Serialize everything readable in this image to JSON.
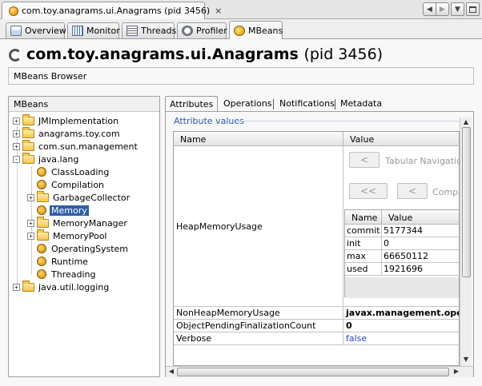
{
  "document_tab": {
    "title": "com.toy.anagrams.ui.Anagrams (pid 3456)",
    "close_glyph": "×"
  },
  "window_controls": {
    "prev_glyph": "◀",
    "next_glyph": "▶",
    "menu_glyph": "▼"
  },
  "tabs": [
    {
      "label": "Overview",
      "icon": "overview-icon"
    },
    {
      "label": "Monitor",
      "icon": "monitor-icon"
    },
    {
      "label": "Threads",
      "icon": "threads-icon"
    },
    {
      "label": "Profiler",
      "icon": "profiler-icon"
    },
    {
      "label": "MBeans",
      "icon": "mbeans-icon",
      "active": true
    }
  ],
  "header": {
    "title": "com.toy.anagrams.ui.Anagrams",
    "pid": "(pid 3456)"
  },
  "browser_label": "MBeans Browser",
  "tree": {
    "header": "MBeans",
    "items": [
      {
        "label": "JMImplementation",
        "type": "folder",
        "expander": "+"
      },
      {
        "label": "anagrams.toy.com",
        "type": "folder",
        "expander": "+"
      },
      {
        "label": "com.sun.management",
        "type": "folder",
        "expander": "+"
      },
      {
        "label": "java.lang",
        "type": "folder",
        "expander": "-"
      },
      {
        "label": "ClassLoading",
        "type": "bean"
      },
      {
        "label": "Compilation",
        "type": "bean"
      },
      {
        "label": "GarbageCollector",
        "type": "folder",
        "expander": "+"
      },
      {
        "label": "Memory",
        "type": "bean",
        "selected": true
      },
      {
        "label": "MemoryManager",
        "type": "folder",
        "expander": "+"
      },
      {
        "label": "MemoryPool",
        "type": "folder",
        "expander": "+"
      },
      {
        "label": "OperatingSystem",
        "type": "bean"
      },
      {
        "label": "Runtime",
        "type": "bean"
      },
      {
        "label": "Threading",
        "type": "bean"
      },
      {
        "label": "java.util.logging",
        "type": "folder",
        "expander": "+"
      }
    ]
  },
  "detail_tabs": [
    {
      "label": "Attributes",
      "active": true
    },
    {
      "label": "Operations"
    },
    {
      "label": "Notifications"
    },
    {
      "label": "Metadata"
    }
  ],
  "attributes": {
    "section_label": "Attribute values",
    "columns": [
      "Name",
      "Value"
    ],
    "navigation": {
      "prev_glyph": "<",
      "tabular_label": "Tabular Navigation",
      "first_glyph": "<<",
      "prev2_glyph": "<",
      "composite_label": "Compos"
    },
    "heap": {
      "name": "HeapMemoryUsage",
      "columns": [
        "Name",
        "Value"
      ],
      "rows": [
        {
          "name": "commit...",
          "value": "5177344"
        },
        {
          "name": "init",
          "value": "0"
        },
        {
          "name": "max",
          "value": "66650112"
        },
        {
          "name": "used",
          "value": "1921696"
        }
      ]
    },
    "rows": [
      {
        "name": "NonHeapMemoryUsage",
        "value": "javax.management.openm"
      },
      {
        "name": "ObjectPendingFinalizationCount",
        "value": "0"
      },
      {
        "name": "Verbose",
        "value": "false"
      }
    ]
  },
  "scroll": {
    "up_glyph": "▲",
    "down_glyph": "▼",
    "left_glyph": "◀",
    "right_glyph": "▶"
  }
}
